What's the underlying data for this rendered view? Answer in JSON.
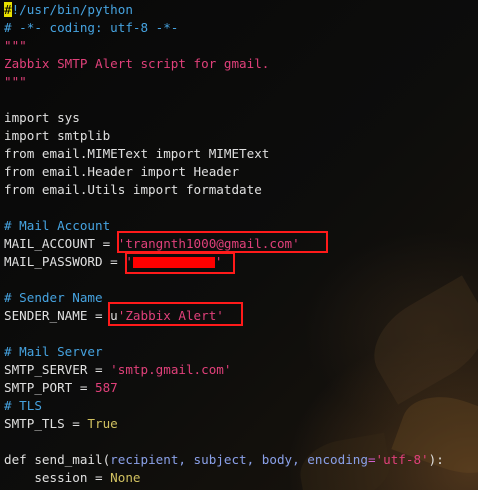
{
  "editor": {
    "cursor_char": "#",
    "lines": [
      {
        "parts": [
          {
            "t": "#",
            "c": "cursor"
          },
          {
            "t": "!/usr/bin/python",
            "c": "c-comment"
          }
        ]
      },
      {
        "parts": [
          {
            "t": "# -*- coding: utf-8 -*-",
            "c": "c-comment"
          }
        ]
      },
      {
        "parts": [
          {
            "t": "\"\"\"",
            "c": "c-doc"
          }
        ]
      },
      {
        "parts": [
          {
            "t": "Zabbix SMTP Alert script for gmail.",
            "c": "c-doc"
          }
        ]
      },
      {
        "parts": [
          {
            "t": "\"\"\"",
            "c": "c-doc"
          }
        ]
      },
      {
        "parts": []
      },
      {
        "parts": [
          {
            "t": "import sys",
            "c": "c-plain"
          }
        ]
      },
      {
        "parts": [
          {
            "t": "import smtplib",
            "c": "c-plain"
          }
        ]
      },
      {
        "parts": [
          {
            "t": "from email.MIMEText import MIMEText",
            "c": "c-plain"
          }
        ]
      },
      {
        "parts": [
          {
            "t": "from email.Header import Header",
            "c": "c-plain"
          }
        ]
      },
      {
        "parts": [
          {
            "t": "from email.Utils import formatdate",
            "c": "c-plain"
          }
        ]
      },
      {
        "parts": []
      },
      {
        "parts": [
          {
            "t": "# Mail Account",
            "c": "c-comment"
          }
        ]
      },
      {
        "parts": [
          {
            "t": "MAIL_ACCOUNT = ",
            "c": "c-plain"
          },
          {
            "t": "'trangnth1000@gmail.com'",
            "c": "c-str"
          }
        ]
      },
      {
        "parts": [
          {
            "t": "MAIL_PASSWORD = ",
            "c": "c-plain"
          },
          {
            "t": "'",
            "c": "c-str"
          },
          {
            "t": "",
            "c": "redacted"
          },
          {
            "t": "'",
            "c": "c-str"
          }
        ]
      },
      {
        "parts": []
      },
      {
        "parts": [
          {
            "t": "# Sender Name",
            "c": "c-comment"
          }
        ]
      },
      {
        "parts": [
          {
            "t": "SENDER_NAME = u",
            "c": "c-plain"
          },
          {
            "t": "'Zabbix Alert'",
            "c": "c-str"
          }
        ]
      },
      {
        "parts": []
      },
      {
        "parts": [
          {
            "t": "# Mail Server",
            "c": "c-comment"
          }
        ]
      },
      {
        "parts": [
          {
            "t": "SMTP_SERVER = ",
            "c": "c-plain"
          },
          {
            "t": "'smtp.gmail.com'",
            "c": "c-str"
          }
        ]
      },
      {
        "parts": [
          {
            "t": "SMTP_PORT = ",
            "c": "c-plain"
          },
          {
            "t": "587",
            "c": "c-num"
          }
        ]
      },
      {
        "parts": [
          {
            "t": "# TLS",
            "c": "c-comment"
          }
        ]
      },
      {
        "parts": [
          {
            "t": "SMTP_TLS = ",
            "c": "c-plain"
          },
          {
            "t": "True",
            "c": "c-const"
          }
        ]
      },
      {
        "parts": []
      },
      {
        "parts": [
          {
            "t": "def send_mail(",
            "c": "c-plain"
          },
          {
            "t": "recipient, subject, body, encoding",
            "c": "c-param"
          },
          {
            "t": "=",
            "c": "c-eq"
          },
          {
            "t": "'utf-8'",
            "c": "c-str"
          },
          {
            "t": "):",
            "c": "c-plain"
          }
        ]
      },
      {
        "parts": [
          {
            "t": "    session = ",
            "c": "c-plain"
          },
          {
            "t": "None",
            "c": "c-const"
          }
        ]
      }
    ]
  },
  "annotations": {
    "color": "#ff1a1a",
    "highlighted_lines": [
      13,
      14,
      17
    ]
  }
}
